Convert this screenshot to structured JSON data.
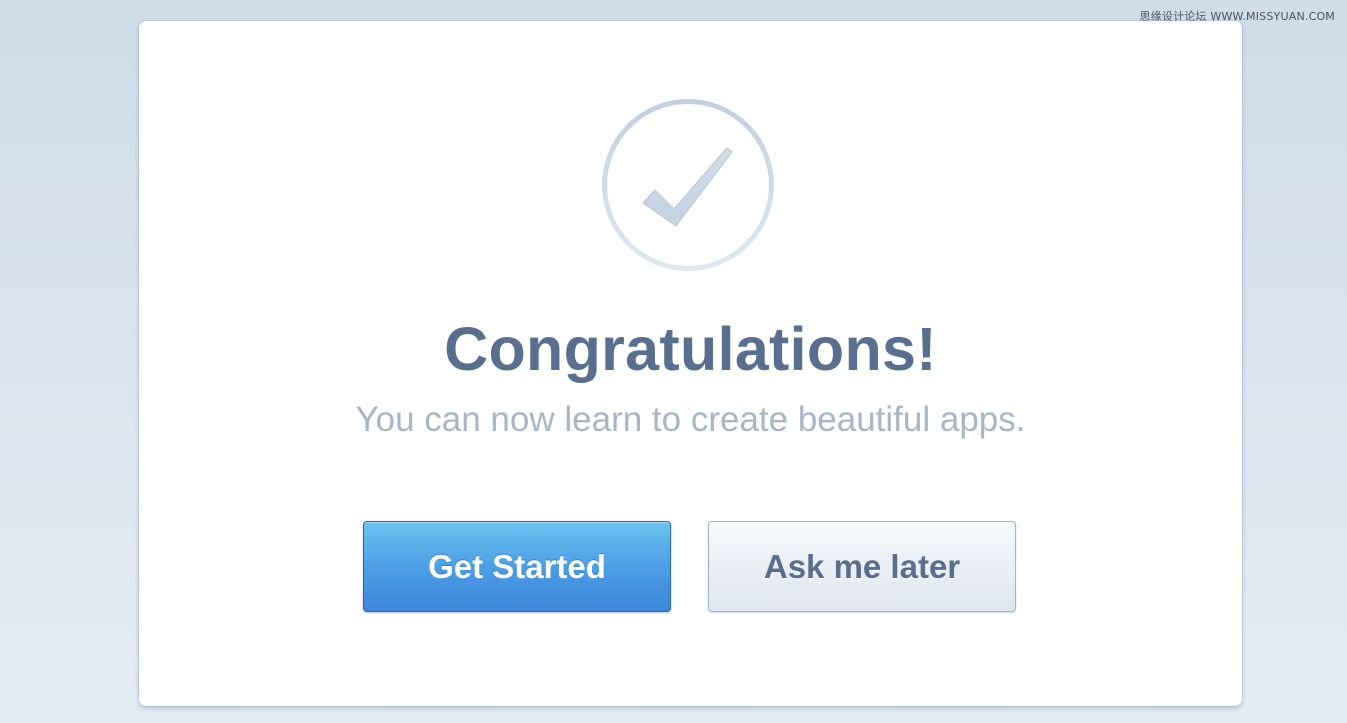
{
  "watermark": {
    "text": "思缘设计论坛 WWW.MISSYUAN.COM"
  },
  "dialog": {
    "icon": "checkmark-circle-icon",
    "title": "Congratulations!",
    "subtitle": "You can now learn to create beautiful apps.",
    "primary_button": "Get Started",
    "secondary_button": "Ask me later"
  },
  "colors": {
    "primary_button": "#4a9be4",
    "title": "#596f90",
    "subtitle": "#a9b5c4",
    "background": "#d6e1ec"
  }
}
